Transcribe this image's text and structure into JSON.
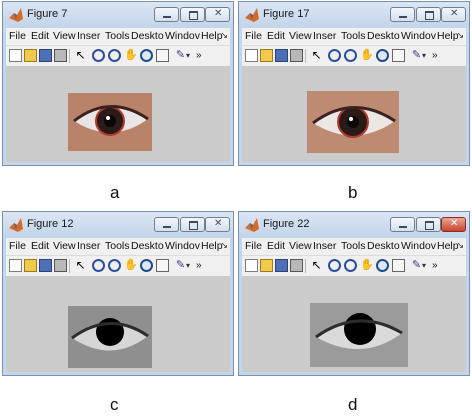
{
  "menus": [
    "File",
    "Edit",
    "View",
    "Inser",
    "Tools",
    "Deskto",
    "Windov",
    "Help"
  ],
  "menu_overflow": "↘",
  "toolbar_icons": [
    "new-file-icon",
    "open-folder-icon",
    "save-icon",
    "print-icon",
    "pointer-icon",
    "zoom-in-icon",
    "zoom-out-icon",
    "pan-hand-icon",
    "rotate-3d-icon",
    "data-cursor-icon",
    "brush-icon",
    "dropdown-icon",
    "more-icon"
  ],
  "pointer_glyph": "↖",
  "pan_glyph": "✋",
  "brush_glyph": "✎",
  "dropdown_glyph": "▾",
  "more_glyph": "»",
  "figures": [
    {
      "title": "Figure 7",
      "caption": "a",
      "image": "color-eye",
      "close_active": false
    },
    {
      "title": "Figure 17",
      "caption": "b",
      "image": "color-eye",
      "close_active": false
    },
    {
      "title": "Figure 12",
      "caption": "c",
      "image": "grayscale-eye-black-pupil",
      "close_active": false
    },
    {
      "title": "Figure 22",
      "caption": "d",
      "image": "grayscale-eye-black-pupil",
      "close_active": true
    }
  ],
  "colors": {
    "canvas": "#cbcbcb",
    "titlebar": "#c4d6ec",
    "close_active": "#c8452f",
    "skin": "#b9836a"
  }
}
